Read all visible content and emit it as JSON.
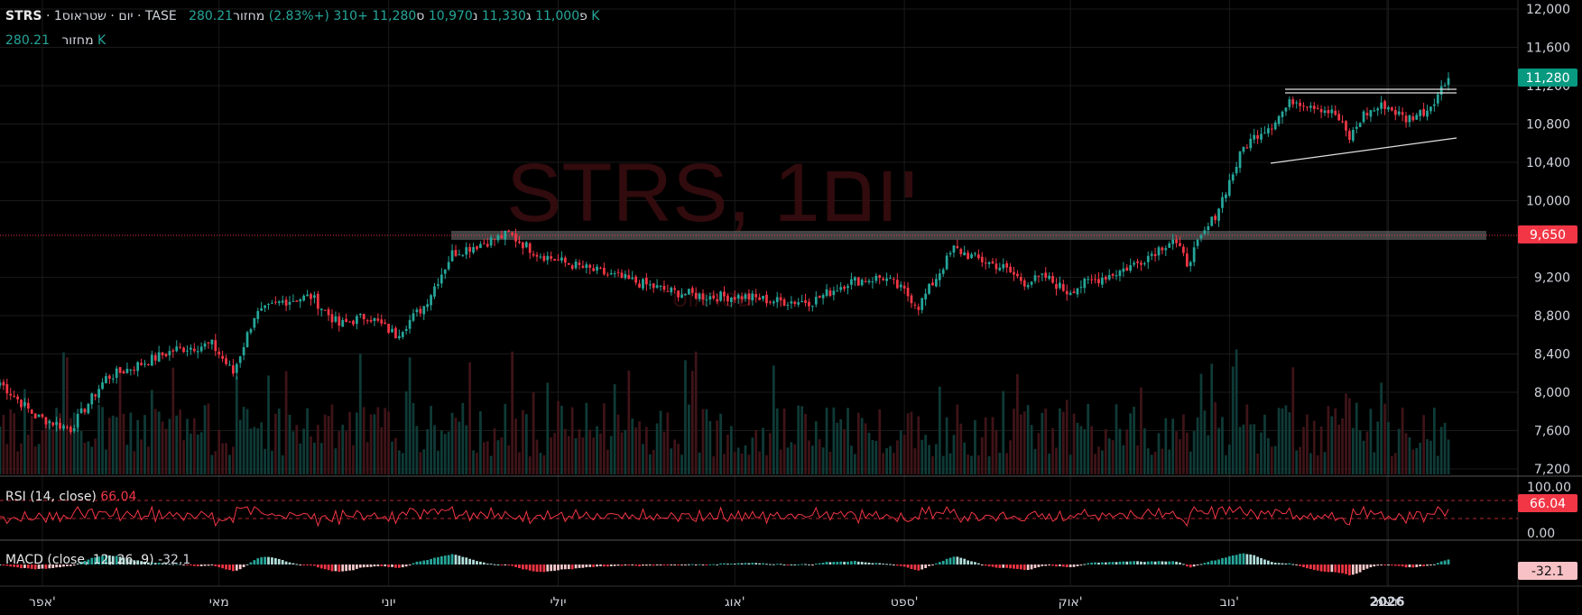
{
  "header": {
    "symbol": "STRS",
    "exchange": "TASE",
    "name": "שטראוס",
    "interval": "1יום",
    "separator": "·",
    "open_label": "פ",
    "open_value": "11,000",
    "high_label": "ג",
    "high_value": "11,330",
    "low_label": "נ",
    "low_value": "10,970",
    "close_label": "ס",
    "close_value": "11,280",
    "change": "+310 (+2.83%)",
    "volume_label": "מחזור",
    "volume_value": "280.21 K"
  },
  "watermark": "STRS, 1יום",
  "watermark_sub": "שטראוס",
  "rsi": {
    "label": "RSI (14, close)",
    "value": "66.04",
    "axis_top": "100.00",
    "axis_bottom": "0.00",
    "overbought": 70,
    "oversold": 30
  },
  "macd": {
    "label": "MACD (close, 12, 26, 9)",
    "value": "-32.1"
  },
  "colors": {
    "up": "#26a69a",
    "down": "#f23645",
    "background": "#000000",
    "grid": "#1a1a1a",
    "zone": "#787878",
    "price_tag": "#089981",
    "level_tag": "#f23645"
  },
  "chart_data": {
    "type": "candlestick",
    "y_ticks": [
      "12,000",
      "11,600",
      "11,200",
      "10,800",
      "10,400",
      "10,000",
      "9,200",
      "8,800",
      "8,400",
      "8,000",
      "7,600",
      "7,200"
    ],
    "ylim": [
      7200,
      12000
    ],
    "x_ticks": [
      "אפר'",
      "מאי",
      "יוני",
      "יולי",
      "אוג'",
      "ספט'",
      "אוק'",
      "נוב'",
      "דצמ'",
      "2026"
    ],
    "last_price": 11280,
    "last_price_label": "11,280",
    "horizontal_level": 9650,
    "horizontal_level_label": "9,650",
    "anchor_prices": [
      [
        0,
        8100
      ],
      [
        10,
        7750
      ],
      [
        20,
        7620
      ],
      [
        30,
        8150
      ],
      [
        40,
        8300
      ],
      [
        50,
        8450
      ],
      [
        60,
        8500
      ],
      [
        66,
        8200
      ],
      [
        72,
        8800
      ],
      [
        80,
        8950
      ],
      [
        88,
        9000
      ],
      [
        96,
        8700
      ],
      [
        104,
        8800
      ],
      [
        112,
        8600
      ],
      [
        120,
        8900
      ],
      [
        128,
        9450
      ],
      [
        136,
        9550
      ],
      [
        144,
        9650
      ],
      [
        152,
        9450
      ],
      [
        160,
        9350
      ],
      [
        170,
        9250
      ],
      [
        180,
        9150
      ],
      [
        190,
        9050
      ],
      [
        200,
        9000
      ],
      [
        210,
        9000
      ],
      [
        220,
        8950
      ],
      [
        230,
        8950
      ],
      [
        240,
        9150
      ],
      [
        250,
        9200
      ],
      [
        256,
        9050
      ],
      [
        260,
        8900
      ],
      [
        265,
        9200
      ],
      [
        270,
        9500
      ],
      [
        276,
        9400
      ],
      [
        284,
        9300
      ],
      [
        290,
        9150
      ],
      [
        296,
        9200
      ],
      [
        302,
        9050
      ],
      [
        308,
        9150
      ],
      [
        316,
        9250
      ],
      [
        322,
        9350
      ],
      [
        328,
        9500
      ],
      [
        332,
        9600
      ],
      [
        336,
        9350
      ],
      [
        340,
        9600
      ],
      [
        344,
        9850
      ],
      [
        348,
        10200
      ],
      [
        352,
        10550
      ],
      [
        356,
        10700
      ],
      [
        360,
        10800
      ],
      [
        366,
        11050
      ],
      [
        372,
        11000
      ],
      [
        378,
        10900
      ],
      [
        382,
        10650
      ],
      [
        386,
        10900
      ],
      [
        392,
        11000
      ],
      [
        398,
        10850
      ],
      [
        404,
        10950
      ],
      [
        410,
        11280
      ]
    ]
  }
}
